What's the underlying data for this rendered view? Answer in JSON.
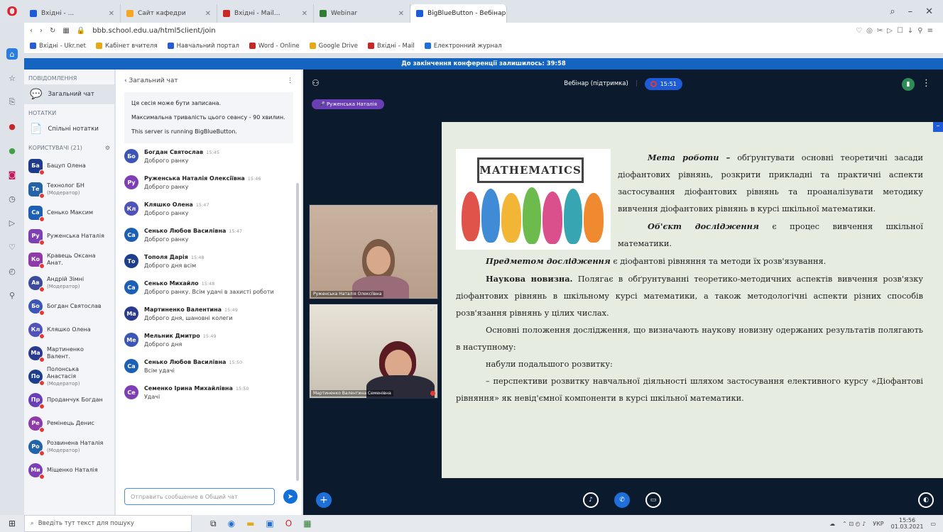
{
  "browser": {
    "tabs": [
      {
        "label": "Вхідні - ...",
        "color": "#1e5bd6"
      },
      {
        "label": "Сайт кафедри",
        "color": "#f5a623"
      },
      {
        "label": "Вхідні - Mail...",
        "color": "#c62828"
      },
      {
        "label": "Webinar",
        "color": "#2e7d32"
      },
      {
        "label": "BigBlueButton - Вебінар",
        "color": "#1e5bd6"
      }
    ],
    "url": "bbb.school.edu.ua/html5client/join",
    "bookmarks": [
      "Вхідні - Ukr.net",
      "Кабінет вчителя",
      "Навчальний портал",
      "Word - Online",
      "Google Drive",
      "Вхідні - Mail",
      "Електронний журнал"
    ]
  },
  "banner": "До закінчення конференції залишилось: 39:58",
  "users_panel": {
    "messages_header": "ПОВІДОМЛЕННЯ",
    "public_chat": "Загальний чат",
    "notes_header": "НОТАТКИ",
    "shared_notes": "Спільні нотатки",
    "users_header": "КОРИСТУВАЧІ (21)",
    "users": [
      {
        "initials": "Ба",
        "name": "Бацуп Олена",
        "sub": "",
        "color": "#1e3a8a",
        "circle": false
      },
      {
        "initials": "Те",
        "name": "Технолог БН",
        "sub": "(Модератор)",
        "color": "#2563a8",
        "circle": false
      },
      {
        "initials": "Са",
        "name": "Сенько Максим",
        "sub": "",
        "color": "#1d5fb5",
        "circle": false
      },
      {
        "initials": "Ру",
        "name": "Руженська Наталія",
        "sub": "",
        "color": "#7e3fb5",
        "circle": false
      },
      {
        "initials": "Ко",
        "name": "Кравець Оксана Анат.",
        "sub": "",
        "color": "#8e3aa8",
        "circle": false
      },
      {
        "initials": "Ав",
        "name": "Андрій Зімні",
        "sub": "(Модератор)",
        "color": "#3b4a9c",
        "circle": true
      },
      {
        "initials": "Бо",
        "name": "Богдан Святослав",
        "sub": "",
        "color": "#3c56b8",
        "circle": true
      },
      {
        "initials": "Кл",
        "name": "Кляшко Олена",
        "sub": "",
        "color": "#4f52b8",
        "circle": true
      },
      {
        "initials": "Ма",
        "name": "Мартиненко Валент.",
        "sub": "",
        "color": "#2a3b8f",
        "circle": true
      },
      {
        "initials": "По",
        "name": "Полонська Анастасія",
        "sub": "(Модератор)",
        "color": "#1c3e8c",
        "circle": true
      },
      {
        "initials": "Пр",
        "name": "Проданчук Богдан",
        "sub": "",
        "color": "#6a3fb5",
        "circle": true
      },
      {
        "initials": "Ре",
        "name": "Ремінець Денис",
        "sub": "",
        "color": "#8e3aa8",
        "circle": true
      },
      {
        "initials": "Ро",
        "name": "Розвинена Наталія",
        "sub": "(Модератор)",
        "color": "#2563a8",
        "circle": true
      },
      {
        "initials": "Ми",
        "name": "Міщенко Наталія",
        "sub": "",
        "color": "#7e3fb5",
        "circle": true
      }
    ]
  },
  "chat": {
    "title": "Загальний чат",
    "system": [
      "Ця сесія може бути записана.",
      "Максимальна тривалість цього сеансу - 90 хвилин.",
      "This server is running BigBlueButton."
    ],
    "messages": [
      {
        "initials": "Бо",
        "color": "#3c56b8",
        "name": "Богдан Святослав",
        "time": "15:45",
        "text": "Доброго ранку"
      },
      {
        "initials": "Ру",
        "color": "#7e3fb5",
        "name": "Руженська Наталія Олексіївна",
        "time": "15:46",
        "text": "Доброго ранку"
      },
      {
        "initials": "Кл",
        "color": "#4f52b8",
        "name": "Кляшко Олена",
        "time": "15:47",
        "text": "Доброго ранку"
      },
      {
        "initials": "Са",
        "color": "#1d5fb5",
        "name": "Сенько Любов Василівна",
        "time": "15:47",
        "text": "Доброго ранку"
      },
      {
        "initials": "То",
        "color": "#1c3e8c",
        "name": "Тополя Дарія",
        "time": "15:48",
        "text": "Доброго дня всім"
      },
      {
        "initials": "Са",
        "color": "#1d5fb5",
        "name": "Сенько Михайло",
        "time": "15:48",
        "text": "Доброго ранку. Всім удачі в захисті роботи"
      },
      {
        "initials": "Ма",
        "color": "#2a3b8f",
        "name": "Мартиненко Валентина",
        "time": "15:49",
        "text": "Доброго дня, шановні колеги"
      },
      {
        "initials": "Ме",
        "color": "#3c56b8",
        "name": "Мельник Дмитро",
        "time": "15:49",
        "text": "Доброго дня"
      },
      {
        "initials": "Са",
        "color": "#1d5fb5",
        "name": "Сенько Любов Василівна",
        "time": "15:50",
        "text": "Всім удачі"
      },
      {
        "initials": "Се",
        "color": "#7e3fb5",
        "name": "Семенко Ірина Михайлівна",
        "time": "15:50",
        "text": "Удачі"
      }
    ],
    "input_placeholder": "Отправить сообщение в Общий чат"
  },
  "main": {
    "title": "Вебінар (підтримка)",
    "record_label": "15:51",
    "talking": "Руженська Наталія",
    "videos": [
      {
        "label": "Руженська Наталія Олексіївна"
      },
      {
        "label": "Мартиненко Валентина Семенівна"
      }
    ]
  },
  "slide": {
    "image_text": "MATHEMATICS",
    "p1_lead": "Мета роботи –",
    "p1_text": " обґрунтувати основні теоретичні засади діофантових рівнянь, розкрити прикладні та практичні аспекти застосування діофантових рівнянь та проаналізувати методику вивчення діофантових рівнянь в курсі шкільної математики.",
    "p2_lead": "Об'єкт дослідження",
    "p2_text": " є процес вивчення шкільної математики.",
    "p3_lead": "Предметом дослідження",
    "p3_text": " є діофантові рівняння та методи їх розв'язування.",
    "p4_lead": "Наукова новизна.",
    "p4_text": " Полягає в обґрунтуванні теоретико-методичних аспектів вивчення розв'язку діофантових рівнянь в шкільному курсі математики, а також методологічні аспекти різних способів розв'язання рівнянь у цілих числах.",
    "p5_text": "Основні положення дослідження, що визначають наукову новизну одержаних результатів полягають в наступному:",
    "p6_text": "набули подальшого розвитку:",
    "p7_text": "–   перспективи розвитку навчальної діяльності шляхом застосування елективного курсу «Діофантові рівняння» як невід'ємної компоненти в курсі шкільної математики."
  },
  "taskbar": {
    "search_placeholder": "Введіть тут текст для пошуку",
    "lang": "УКР",
    "time": "15:56",
    "date": "01.03.2021"
  }
}
